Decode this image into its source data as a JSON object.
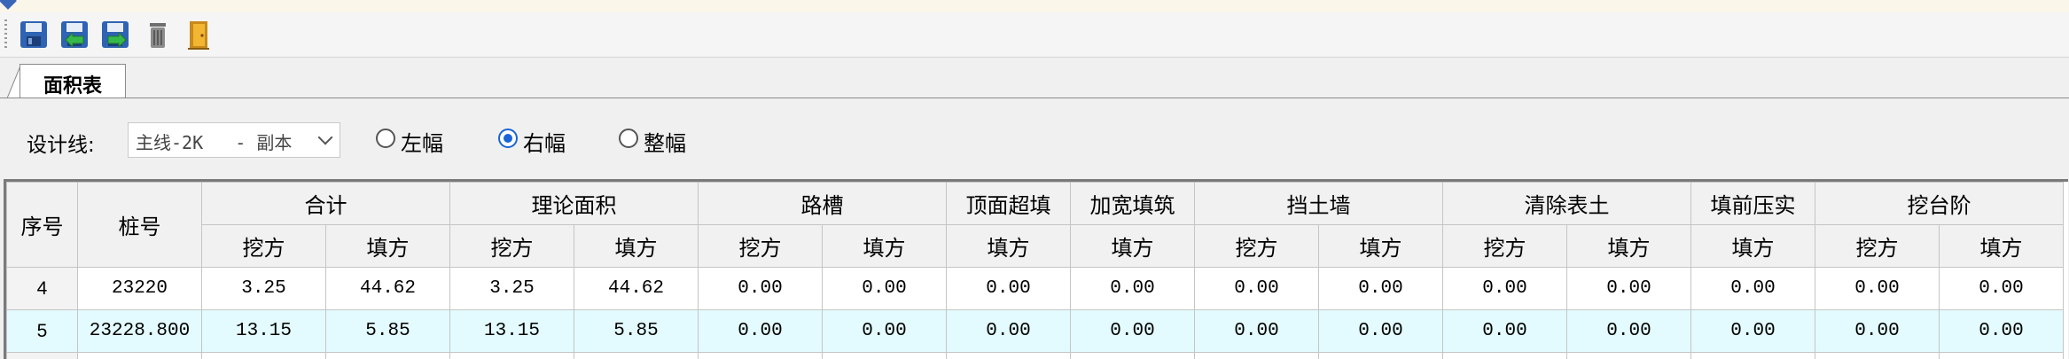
{
  "window": {
    "title": ""
  },
  "toolbar": {
    "buttons": [
      {
        "name": "save-icon"
      },
      {
        "name": "import-icon"
      },
      {
        "name": "export-icon"
      },
      {
        "name": "delete-icon"
      },
      {
        "name": "exit-door-icon"
      }
    ]
  },
  "tabs": [
    {
      "label": "面积表",
      "active": true
    }
  ],
  "filter": {
    "design_line_label": "设计线:",
    "design_line_value": "主线-2K   - 副本",
    "radios": [
      {
        "label": "左幅",
        "checked": false
      },
      {
        "label": "右幅",
        "checked": true
      },
      {
        "label": "整幅",
        "checked": false
      }
    ]
  },
  "table": {
    "col_seq": "序号",
    "col_station": "桩号",
    "groups": [
      "合计",
      "理论面积",
      "路槽",
      "顶面超填",
      "加宽填筑",
      "挡土墙",
      "清除表土",
      "填前压实",
      "挖台阶"
    ],
    "sub": [
      "挖方",
      "填方",
      "挖方",
      "填方",
      "挖方",
      "填方",
      "填方",
      "填方",
      "挖方",
      "填方",
      "挖方",
      "填方",
      "填方",
      "挖方",
      "填方"
    ],
    "rows": [
      {
        "seq": "4",
        "station": "23220",
        "cells": [
          "3.25",
          "44.62",
          "3.25",
          "44.62",
          "0.00",
          "0.00",
          "0.00",
          "0.00",
          "0.00",
          "0.00",
          "0.00",
          "0.00",
          "0.00",
          "0.00",
          "0.00"
        ]
      },
      {
        "seq": "5",
        "station": "23228.800",
        "cells": [
          "13.15",
          "5.85",
          "13.15",
          "5.85",
          "0.00",
          "0.00",
          "0.00",
          "0.00",
          "0.00",
          "0.00",
          "0.00",
          "0.00",
          "0.00",
          "0.00",
          "0.00"
        ]
      }
    ]
  },
  "colors": {
    "accent": "#1a64d6",
    "selected_row": "#e3fbfe"
  }
}
